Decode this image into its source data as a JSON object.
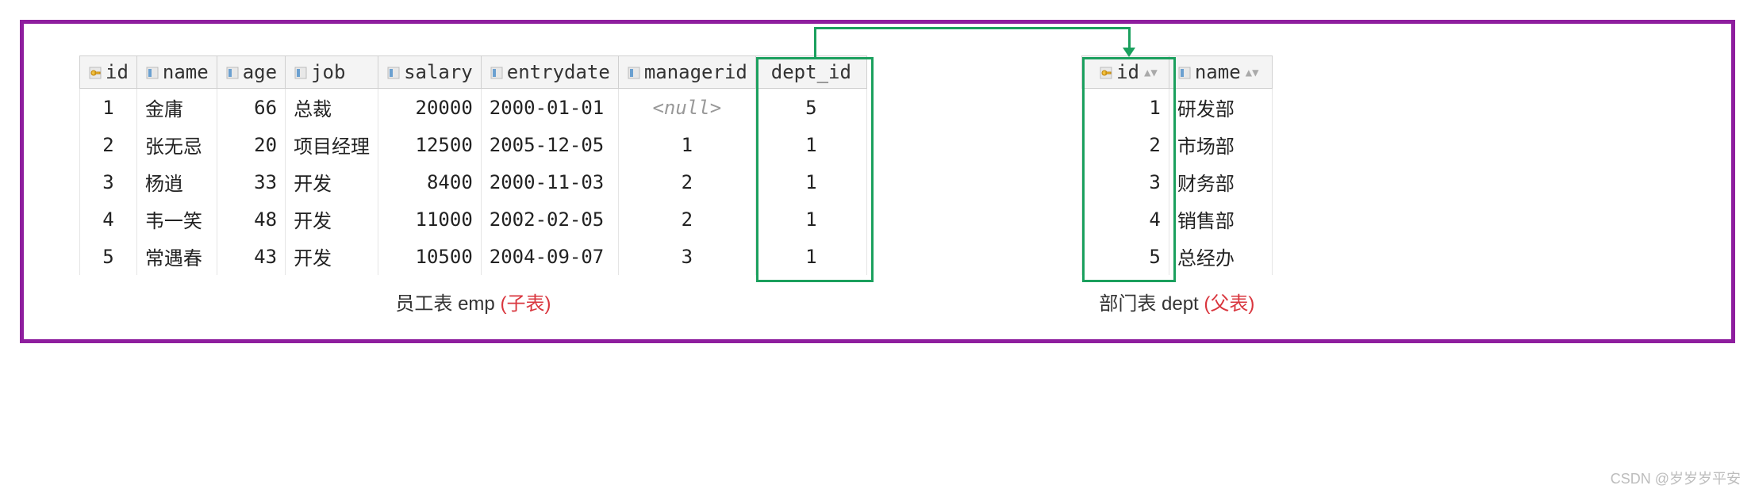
{
  "emp": {
    "headers": {
      "id": "id",
      "name": "name",
      "age": "age",
      "job": "job",
      "salary": "salary",
      "entrydate": "entrydate",
      "managerid": "managerid",
      "dept_id": "dept_id"
    },
    "rows": [
      {
        "id": "1",
        "name": "金庸",
        "age": "66",
        "job": "总裁",
        "salary": "20000",
        "entrydate": "2000-01-01",
        "managerid": "<null>",
        "managerid_null": true,
        "dept_id": "5"
      },
      {
        "id": "2",
        "name": "张无忌",
        "age": "20",
        "job": "项目经理",
        "salary": "12500",
        "entrydate": "2005-12-05",
        "managerid": "1",
        "dept_id": "1"
      },
      {
        "id": "3",
        "name": "杨逍",
        "age": "33",
        "job": "开发",
        "salary": "8400",
        "entrydate": "2000-11-03",
        "managerid": "2",
        "dept_id": "1"
      },
      {
        "id": "4",
        "name": "韦一笑",
        "age": "48",
        "job": "开发",
        "salary": "11000",
        "entrydate": "2002-02-05",
        "managerid": "2",
        "dept_id": "1"
      },
      {
        "id": "5",
        "name": "常遇春",
        "age": "43",
        "job": "开发",
        "salary": "10500",
        "entrydate": "2004-09-07",
        "managerid": "3",
        "dept_id": "1"
      }
    ],
    "caption_prefix": "员工表 emp ",
    "caption_suffix": "(子表)"
  },
  "dept": {
    "headers": {
      "id": "id",
      "name": "name"
    },
    "rows": [
      {
        "id": "1",
        "name": "研发部"
      },
      {
        "id": "2",
        "name": "市场部"
      },
      {
        "id": "3",
        "name": "财务部"
      },
      {
        "id": "4",
        "name": "销售部"
      },
      {
        "id": "5",
        "name": "总经办"
      }
    ],
    "caption_prefix": "部门表 dept ",
    "caption_suffix": "(父表)"
  },
  "watermark": "CSDN @岁岁岁平安",
  "chart_data": {
    "type": "table",
    "description": "Relational DB diagram: foreign key emp.dept_id references dept.id",
    "tables": [
      {
        "name": "emp",
        "columns": [
          "id",
          "name",
          "age",
          "job",
          "salary",
          "entrydate",
          "managerid",
          "dept_id"
        ],
        "rows": [
          [
            1,
            "金庸",
            66,
            "总裁",
            20000,
            "2000-01-01",
            null,
            5
          ],
          [
            2,
            "张无忌",
            20,
            "项目经理",
            12500,
            "2005-12-05",
            1,
            1
          ],
          [
            3,
            "杨逍",
            33,
            "开发",
            8400,
            "2000-11-03",
            2,
            1
          ],
          [
            4,
            "韦一笑",
            48,
            "开发",
            11000,
            "2002-02-05",
            2,
            1
          ],
          [
            5,
            "常遇春",
            43,
            "开发",
            10500,
            "2004-09-07",
            3,
            1
          ]
        ]
      },
      {
        "name": "dept",
        "columns": [
          "id",
          "name"
        ],
        "rows": [
          [
            1,
            "研发部"
          ],
          [
            2,
            "市场部"
          ],
          [
            3,
            "财务部"
          ],
          [
            4,
            "销售部"
          ],
          [
            5,
            "总经办"
          ]
        ]
      }
    ],
    "relationship": {
      "from": "emp.dept_id",
      "to": "dept.id",
      "type": "foreign_key"
    }
  }
}
